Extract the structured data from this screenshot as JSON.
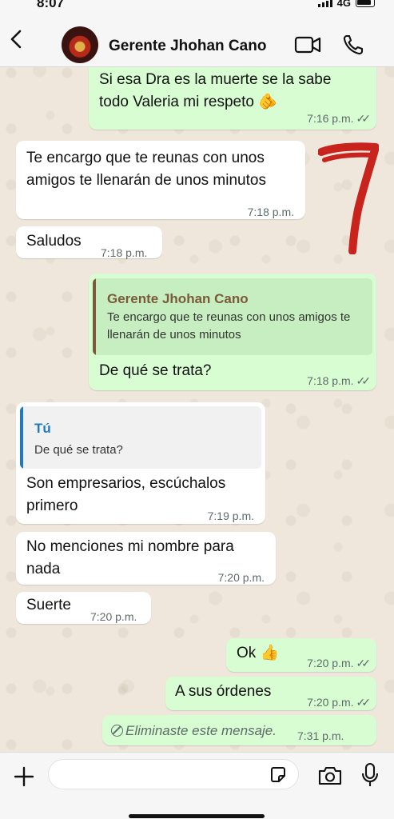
{
  "status_bar": {
    "time": "8:07",
    "network": "4G"
  },
  "header": {
    "contact_name": "Gerente Jhohan Cano"
  },
  "messages": [
    {
      "text": "Si esa Dra es la muerte se la sabe todo Valeria mi respeto 🫵",
      "time": "7:16 p.m.",
      "ticks": "✓✓"
    },
    {
      "text": "Te encargo que te reunas con unos amigos te llenarán de unos minutos",
      "time": "7:18 p.m."
    },
    {
      "text": "Saludos",
      "time": "7:18 p.m."
    },
    {
      "quote_name": "Gerente Jhohan Cano",
      "quote_text": "Te encargo que te reunas con unos amigos te llenarán de unos minutos",
      "text": "De qué se trata?",
      "time": "7:18 p.m.",
      "ticks": "✓✓"
    },
    {
      "quote_name": "Tú",
      "quote_text": "De qué se trata?",
      "text": "Son empresarios, escúchalos primero",
      "time": "7:19 p.m."
    },
    {
      "text": "No menciones mi nombre para nada",
      "time": "7:20 p.m."
    },
    {
      "text": "Suerte",
      "time": "7:20 p.m."
    },
    {
      "text": "Ok 👍",
      "time": "7:20 p.m.",
      "ticks": "✓✓"
    },
    {
      "text": "A sus órdenes",
      "time": "7:20 p.m.",
      "ticks": "✓✓"
    },
    {
      "text": "Eliminaste este mensaje.",
      "time": "7:31 p.m."
    }
  ],
  "annotation": {
    "text": "7",
    "color": "#c8231c"
  },
  "colors": {
    "outgoing_bubble": "#d9fdd3",
    "incoming_bubble": "#ffffff",
    "quote_name_self": "#7a5a3a",
    "quote_name_you": "#1f7ac3",
    "wallpaper": "#efe7dc"
  },
  "input": {
    "placeholder": "",
    "value": ""
  },
  "icons": [
    "back-chevron-icon",
    "video-call-icon",
    "phone-call-icon",
    "plus-icon",
    "sticker-icon",
    "camera-icon",
    "microphone-icon",
    "deleted-message-icon",
    "read-receipt-icon"
  ]
}
